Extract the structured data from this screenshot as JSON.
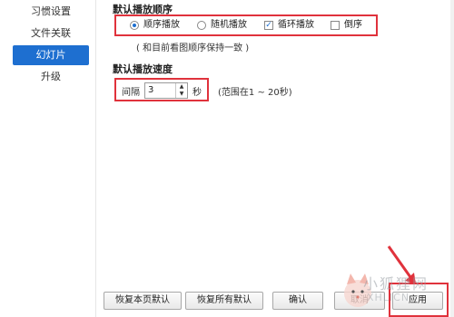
{
  "sidebar": {
    "items": [
      {
        "label": "习惯设置"
      },
      {
        "label": "文件关联"
      },
      {
        "label": "幻灯片"
      },
      {
        "label": "升级"
      }
    ]
  },
  "order_section": {
    "title": "默认播放顺序",
    "options": [
      {
        "label": "顺序播放",
        "type": "radio",
        "checked": true
      },
      {
        "label": "随机播放",
        "type": "radio",
        "checked": false
      },
      {
        "label": "循环播放",
        "type": "checkbox",
        "checked": true
      },
      {
        "label": "倒序",
        "type": "checkbox",
        "checked": false
      }
    ],
    "note": "( 和目前看图顺序保持一致 )"
  },
  "speed_section": {
    "title": "默认播放速度",
    "interval_label": "间隔",
    "interval_value": "3",
    "unit": "秒",
    "range_note": "(范围在1 ~ 20秒)"
  },
  "buttons": {
    "restore_page": "恢复本页默认",
    "restore_all": "恢复所有默认",
    "ok": "确认",
    "cancel": "取消",
    "apply": "应用"
  },
  "watermark": {
    "text": "小狐狸网",
    "sub": "XHLICN"
  },
  "colors": {
    "accent": "#1e6fd0",
    "highlight_box": "#e0323c"
  }
}
